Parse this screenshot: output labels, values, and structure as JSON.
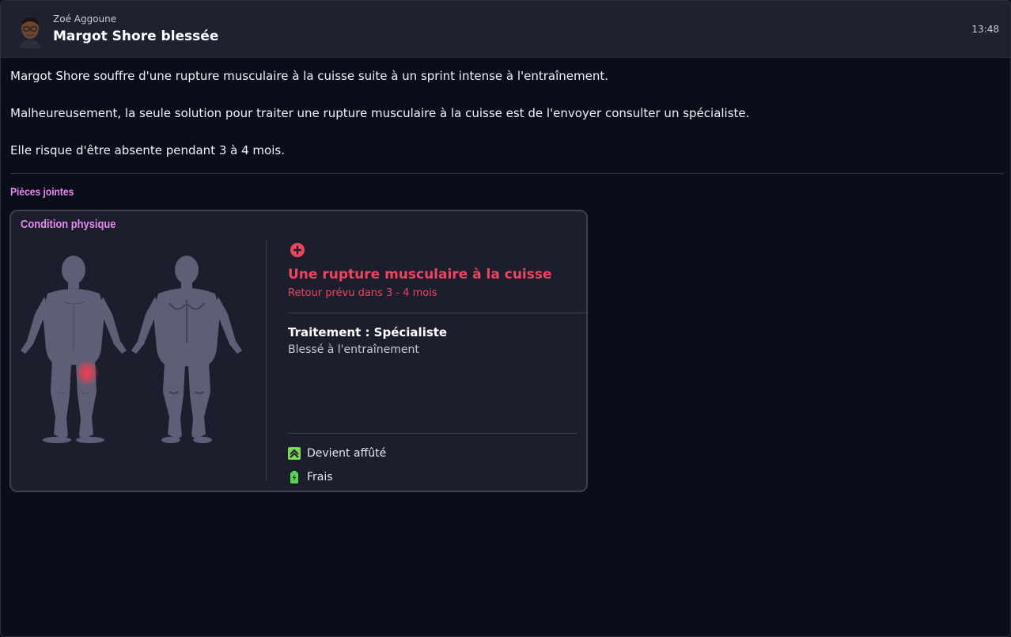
{
  "message": {
    "sender": "Zoé Aggoune",
    "subject": "Margot Shore blessée",
    "time": "13:48",
    "paragraphs": [
      "Margot Shore souffre d'une rupture musculaire à la cuisse suite à un sprint intense à l'entraînement.",
      "Malheureusement, la seule solution pour traiter une rupture musculaire à la cuisse est de l'envoyer consulter un spécialiste.",
      "Elle risque d'être absente pendant 3 à 4 mois."
    ]
  },
  "attachments": {
    "title": "Pièces jointes",
    "card": {
      "title": "Condition physique",
      "injury_name": "Une rupture musculaire à la cuisse",
      "injury_return": "Retour prévu dans 3 - 4 mois",
      "treatment": "Traitement :  Spécialiste",
      "treatment_sub": "Blessé à l'entraînement",
      "statuses": [
        {
          "label": "Devient affûté",
          "icon": "sharpness-up-icon",
          "color": "#7ed957"
        },
        {
          "label": "Frais",
          "icon": "battery-full-icon",
          "color": "#58d64a"
        }
      ]
    }
  },
  "colors": {
    "injury": "#f0455e",
    "section_title": "#e58cf0",
    "header_bg": "#1e2130",
    "page_bg": "#0a0e1a",
    "card_bg": "#1c1d2d"
  }
}
